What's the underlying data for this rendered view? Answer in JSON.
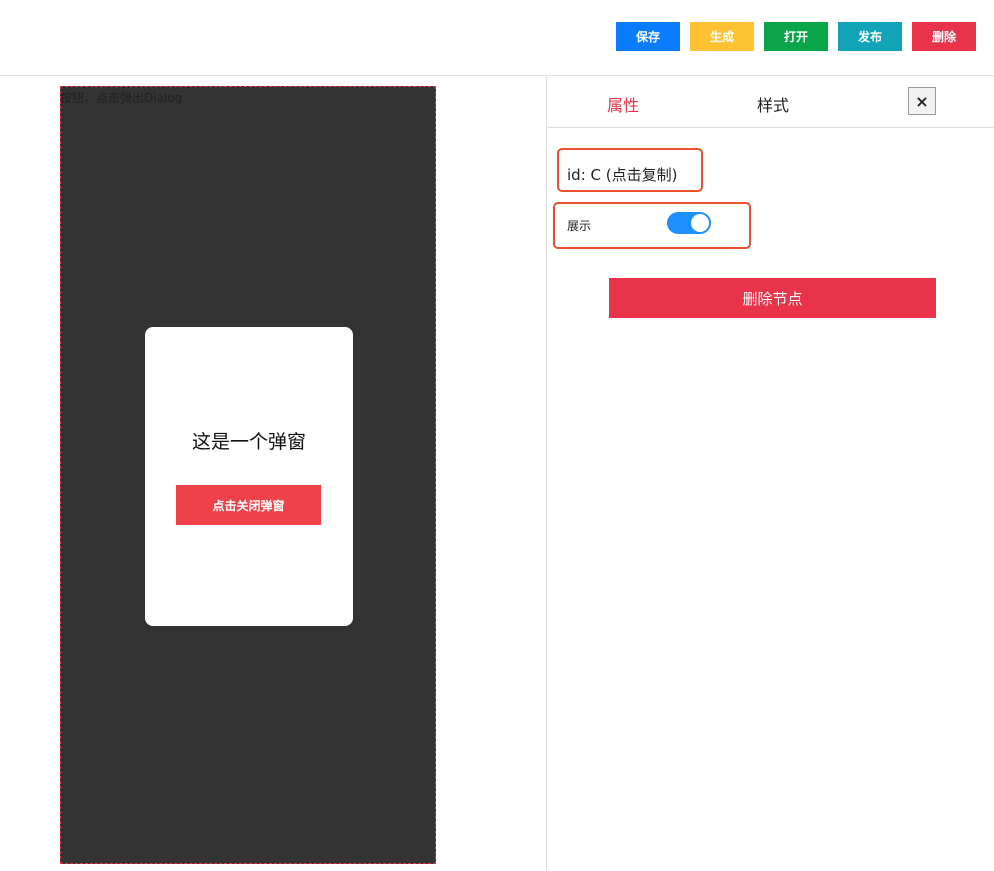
{
  "toolbar": {
    "buttons": [
      {
        "label": "保存",
        "color": "#0a7cff"
      },
      {
        "label": "生成",
        "color": "#ffc233"
      },
      {
        "label": "打开",
        "color": "#0aa54a"
      },
      {
        "label": "发布",
        "color": "#12a3b8"
      },
      {
        "label": "删除",
        "color": "#e8334a"
      }
    ]
  },
  "canvas": {
    "component_label": "按钮，点击弹出Dialog",
    "dialog": {
      "title": "这是一个弹窗",
      "close_button": "点击关闭弹窗"
    }
  },
  "panel": {
    "tabs": [
      {
        "label": "属性",
        "active": true
      },
      {
        "label": "样式",
        "active": false
      }
    ],
    "close_glyph": "×",
    "id_text": "id:  C (点击复制)",
    "show_label": "展示",
    "show_toggle": true,
    "delete_node_label": "删除节点"
  },
  "colors": {
    "accent": "#e8334a",
    "toggle_on": "#1e8fff",
    "highlight_border": "#e8502e",
    "phone_bg": "#333333"
  }
}
